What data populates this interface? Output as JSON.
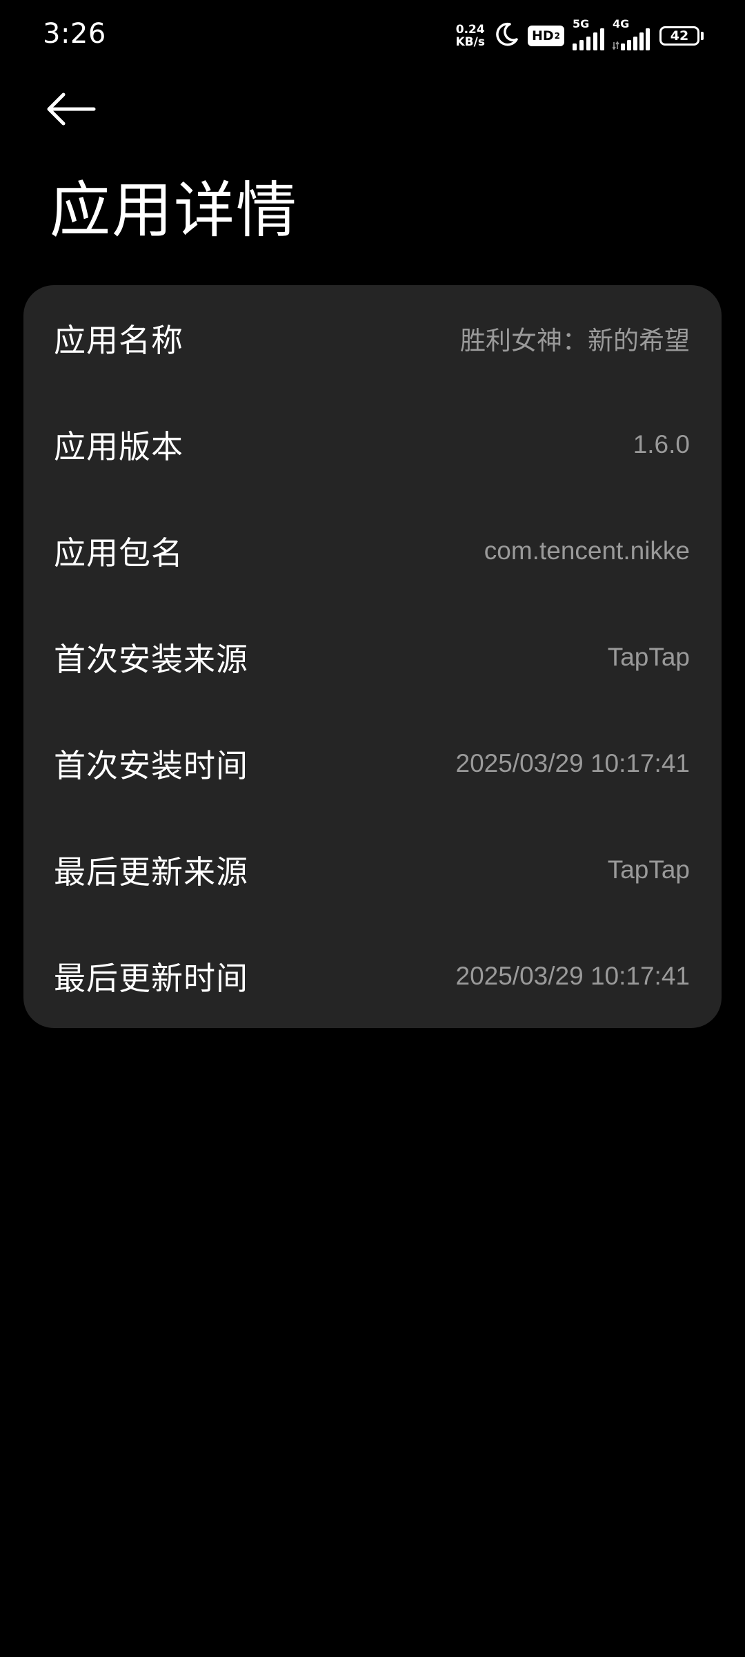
{
  "status_bar": {
    "time": "3:26",
    "net_speed_value": "0.24",
    "net_speed_unit": "KB/s",
    "hd_label": "HD",
    "hd_sub": "2",
    "sig1_label": "5G",
    "sig2_label": "4G",
    "battery_level": "42"
  },
  "header": {
    "title": "应用详情"
  },
  "details": [
    {
      "label": "应用名称",
      "value": "胜利女神：新的希望"
    },
    {
      "label": "应用版本",
      "value": "1.6.0"
    },
    {
      "label": "应用包名",
      "value": "com.tencent.nikke"
    },
    {
      "label": "首次安装来源",
      "value": "TapTap"
    },
    {
      "label": "首次安装时间",
      "value": "2025/03/29 10:17:41"
    },
    {
      "label": "最后更新来源",
      "value": "TapTap"
    },
    {
      "label": "最后更新时间",
      "value": "2025/03/29 10:17:41"
    }
  ],
  "colors": {
    "background": "#000000",
    "card": "#252525",
    "label": "#ffffff",
    "value": "#9a9a9a"
  }
}
